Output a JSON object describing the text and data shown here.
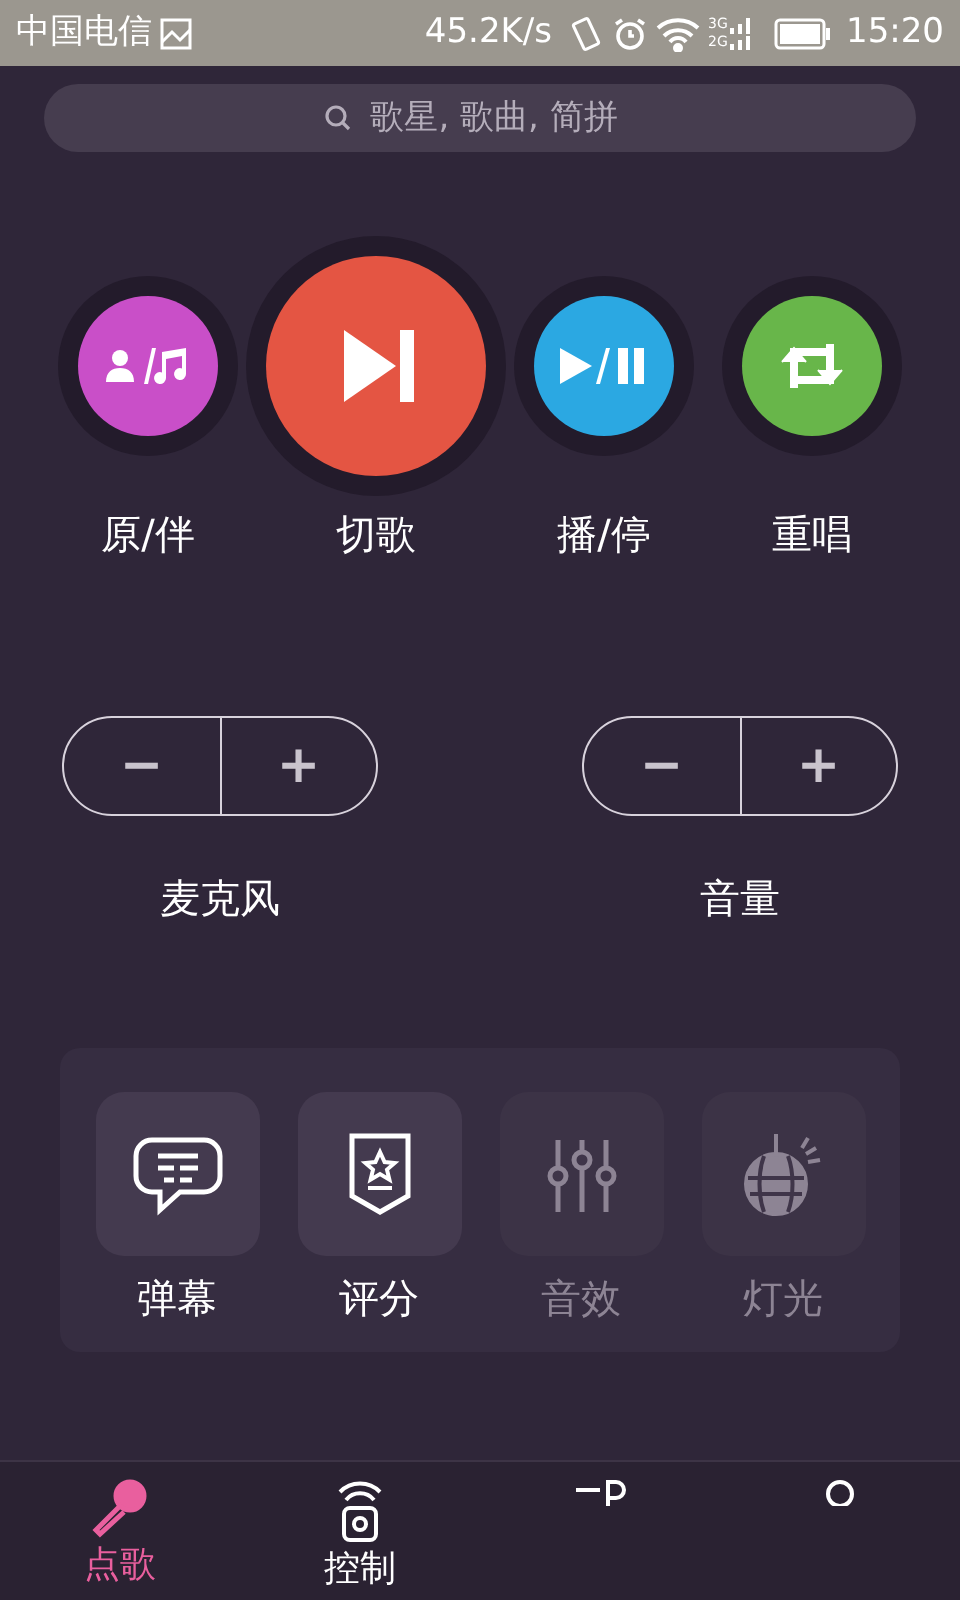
{
  "status_bar": {
    "carrier": "中国电信",
    "speed": "45.2K/s",
    "network": "3G 2G",
    "time": "15:20"
  },
  "search": {
    "placeholder": "歌星, 歌曲, 简拼"
  },
  "controls": [
    {
      "kind": "vocal",
      "label": "原/伴",
      "color": "#c94fc8"
    },
    {
      "kind": "next",
      "label": "切歌",
      "color": "#e45543"
    },
    {
      "kind": "playpause",
      "label": "播/停",
      "color": "#2ba8e2"
    },
    {
      "kind": "repeat",
      "label": "重唱",
      "color": "#68b64a"
    }
  ],
  "steppers": [
    {
      "label": "麦克风",
      "minus": "−",
      "plus": "+"
    },
    {
      "label": "音量",
      "minus": "−",
      "plus": "+"
    }
  ],
  "features": [
    {
      "kind": "danmaku",
      "label": "弹幕",
      "disabled": false
    },
    {
      "kind": "score",
      "label": "评分",
      "disabled": false
    },
    {
      "kind": "effects",
      "label": "音效",
      "disabled": true
    },
    {
      "kind": "lights",
      "label": "灯光",
      "disabled": true
    }
  ],
  "bottom_nav": [
    {
      "kind": "mic",
      "label": "点歌",
      "selected": true
    },
    {
      "kind": "remote",
      "label": "控制",
      "selected": false
    },
    {
      "kind": "tab3",
      "selected": false
    },
    {
      "kind": "tab4",
      "selected": false
    }
  ]
}
